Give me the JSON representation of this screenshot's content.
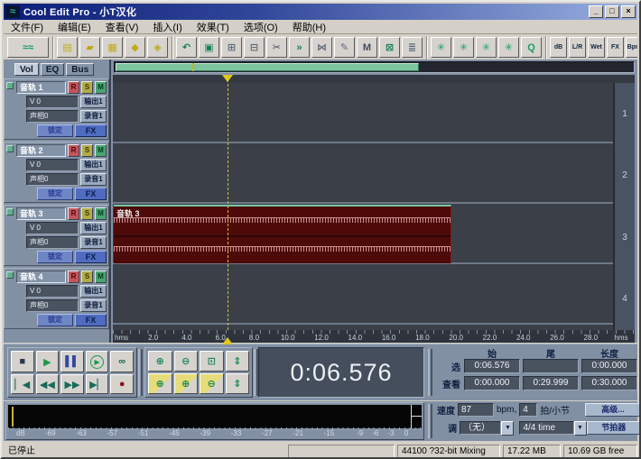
{
  "window": {
    "title": "Cool Edit Pro - 小T汉化",
    "buttons": {
      "minimize": "_",
      "restore": "□",
      "close": "×"
    },
    "app_icon_glyph": "≈"
  },
  "menu": {
    "items": [
      "文件(F)",
      "编辑(E)",
      "查看(V)",
      "插入(I)",
      "效果(T)",
      "选项(O)",
      "帮助(H)"
    ]
  },
  "toolbar": {
    "groups": [
      [
        {
          "name": "edit-waveform-view-button",
          "glyph": "≈≈",
          "color": "#18a060",
          "wide": true
        }
      ],
      [
        {
          "name": "new-session-button",
          "glyph": "▤",
          "color": "#c0a818"
        },
        {
          "name": "open-file-button",
          "glyph": "▰",
          "color": "#c0a818"
        },
        {
          "name": "import-file-button",
          "glyph": "▦",
          "color": "#c0a818"
        },
        {
          "name": "save-button",
          "glyph": "◆",
          "color": "#c0a818"
        },
        {
          "name": "save-as-button",
          "glyph": "◈",
          "color": "#c0a818"
        }
      ],
      [
        {
          "name": "undo-button",
          "glyph": "↶",
          "color": "#1a8050"
        },
        {
          "name": "group-clips-button",
          "glyph": "▣",
          "color": "#1a8050"
        },
        {
          "name": "duplicate-clip-button",
          "glyph": "⊞",
          "color": "#5a6878"
        },
        {
          "name": "trim-clip-button",
          "glyph": "⊟",
          "color": "#5a6878"
        },
        {
          "name": "cut-button",
          "glyph": "✂",
          "color": "#404e5e"
        },
        {
          "name": "splice-button",
          "glyph": "»",
          "color": "#1a8050"
        },
        {
          "name": "crossfade-button",
          "glyph": "⋈",
          "color": "#5a6878"
        },
        {
          "name": "draw-envelope-button",
          "glyph": "✎",
          "color": "#5a6878"
        },
        {
          "name": "mute-clip-button",
          "glyph": "M",
          "color": "#404e5e"
        },
        {
          "name": "lock-clip-button",
          "glyph": "⊠",
          "color": "#1a8050"
        },
        {
          "name": "clip-layers-button",
          "glyph": "≣",
          "color": "#5a6878"
        }
      ],
      [
        {
          "name": "fx-rack-button",
          "glyph": "✳",
          "color": "#18a060"
        },
        {
          "name": "fx-wet-dry-button",
          "glyph": "✳",
          "color": "#18a060"
        },
        {
          "name": "fx-q-button",
          "glyph": "✳",
          "color": "#18a060"
        },
        {
          "name": "fx-quantize-button",
          "glyph": "✳",
          "color": "#18a060"
        },
        {
          "name": "fx-apply-button",
          "glyph": "Q",
          "color": "#18a060"
        }
      ],
      [
        {
          "name": "envelope-volume-button",
          "glyph": "dB",
          "color": "#102040",
          "txt": true,
          "narrow": true
        },
        {
          "name": "envelope-pan-button",
          "glyph": "L/R",
          "color": "#102040",
          "txt": true,
          "narrow": true
        },
        {
          "name": "envelope-wet-button",
          "glyph": "Wet",
          "color": "#102040",
          "txt": true,
          "narrow": true
        },
        {
          "name": "envelope-fx-button",
          "glyph": "FX",
          "color": "#102040",
          "txt": true,
          "narrow": true
        },
        {
          "name": "envelope-tempo-button",
          "glyph": "Bpm",
          "color": "#102040",
          "txt": true,
          "narrow": true
        },
        {
          "name": "envelope-node-button",
          "glyph": "◇",
          "color": "#1a8050",
          "narrow": true
        },
        {
          "name": "show-wave-button",
          "glyph": "≈",
          "color": "#1a8050",
          "narrow": true
        }
      ],
      [
        {
          "name": "settings-gear-icon",
          "glyph": "✱",
          "color": "#b0a020"
        },
        {
          "name": "session-clock-icon",
          "glyph": "◕",
          "color": "#1a8050"
        }
      ]
    ]
  },
  "trackpanel": {
    "tabs": [
      "Vol",
      "EQ",
      "Bus"
    ],
    "track_names": [
      "音轨  1",
      "音轨  2",
      "音轨  3",
      "音轨  4"
    ],
    "fields": {
      "record_arm": "R",
      "solo": "S",
      "mute": "M",
      "volume": "V 0",
      "output": "输出1",
      "pan": "声相0",
      "record_input": "录音1",
      "lock": "锁定",
      "fx": "FX"
    }
  },
  "session": {
    "clip_label": "音轨 3",
    "track_numbers": [
      "1",
      "2",
      "3",
      "4"
    ],
    "ruler_ticks": [
      "hms",
      "2.0",
      "4.0",
      "6.0",
      "8.0",
      "10.0",
      "12.0",
      "14.0",
      "16.0",
      "18.0",
      "20.0",
      "22.0",
      "24.0",
      "26.0",
      "28.0",
      "hms"
    ]
  },
  "transport": {
    "buttons": [
      {
        "name": "stop-button",
        "glyph": "■",
        "color": "#2a3550"
      },
      {
        "name": "play-button",
        "glyph": "▶",
        "color": "#1a9a4a"
      },
      {
        "name": "pause-button",
        "glyph": "▌▌",
        "color": "#3048a0"
      },
      {
        "name": "play-looped-button",
        "glyph": "▶",
        "color": "#1a9a4a",
        "circle": true
      },
      {
        "name": "loop-button",
        "glyph": "∞",
        "color": "#186a3a"
      },
      {
        "name": "go-to-start-button",
        "glyph": "▏◀",
        "color": "#186a5a"
      },
      {
        "name": "rewind-button",
        "glyph": "◀◀",
        "color": "#186a5a"
      },
      {
        "name": "fast-forward-button",
        "glyph": "▶▶",
        "color": "#186a5a"
      },
      {
        "name": "go-to-end-button",
        "glyph": "▶▏",
        "color": "#186a5a"
      },
      {
        "name": "record-button",
        "glyph": "●",
        "color": "#8a1010"
      }
    ]
  },
  "zoom": {
    "buttons": [
      {
        "name": "zoom-in-button",
        "glyph": "⊕",
        "color": "#18865a"
      },
      {
        "name": "zoom-out-button",
        "glyph": "⊖",
        "color": "#18865a"
      },
      {
        "name": "zoom-full-button",
        "glyph": "⊡",
        "color": "#18865a"
      },
      {
        "name": "zoom-vertical-in-button",
        "glyph": "⇕",
        "color": "#18865a"
      },
      {
        "name": "zoom-to-selection-button",
        "glyph": "⊕",
        "color": "#18865a",
        "yellow": true
      },
      {
        "name": "zoom-left-edge-button",
        "glyph": "⊕",
        "color": "#18865a",
        "yellow": true
      },
      {
        "name": "zoom-right-edge-button",
        "glyph": "⊖",
        "color": "#18865a",
        "yellow": true
      },
      {
        "name": "zoom-vertical-out-button",
        "glyph": "⇕",
        "color": "#18865a"
      }
    ]
  },
  "time_display": "0:06.576",
  "selection_panel": {
    "headers": [
      "始",
      "尾",
      "长度"
    ],
    "rows": [
      {
        "label": "选",
        "values": [
          "0:06.576",
          "",
          "0:00.000"
        ]
      },
      {
        "label": "查看",
        "values": [
          "0:00.000",
          "0:29.999",
          "0:30.000"
        ]
      }
    ]
  },
  "meter": {
    "labels": [
      "dB",
      "-69",
      "-63",
      "-57",
      "-51",
      "-45",
      "-39",
      "-33",
      "-27",
      "-21",
      "-15",
      "-9",
      "-6",
      "-3",
      "0"
    ]
  },
  "tempo": {
    "speed_label": "速度",
    "bpm_value": "87",
    "bpm_unit": "bpm,",
    "beats_value": "4",
    "beats_unit": "拍/小节",
    "advanced_button": "高级...",
    "key_label": "调",
    "key_value": "（无）",
    "time_sig_value": "4/4 time",
    "metronome_button": "节拍器",
    "dropdown_arrow": "▼"
  },
  "status_bar": {
    "message": "已停止",
    "cells": [
      "",
      "44100 ?32-bit Mixing",
      "17.22 MB",
      "10.69 GB free"
    ]
  }
}
